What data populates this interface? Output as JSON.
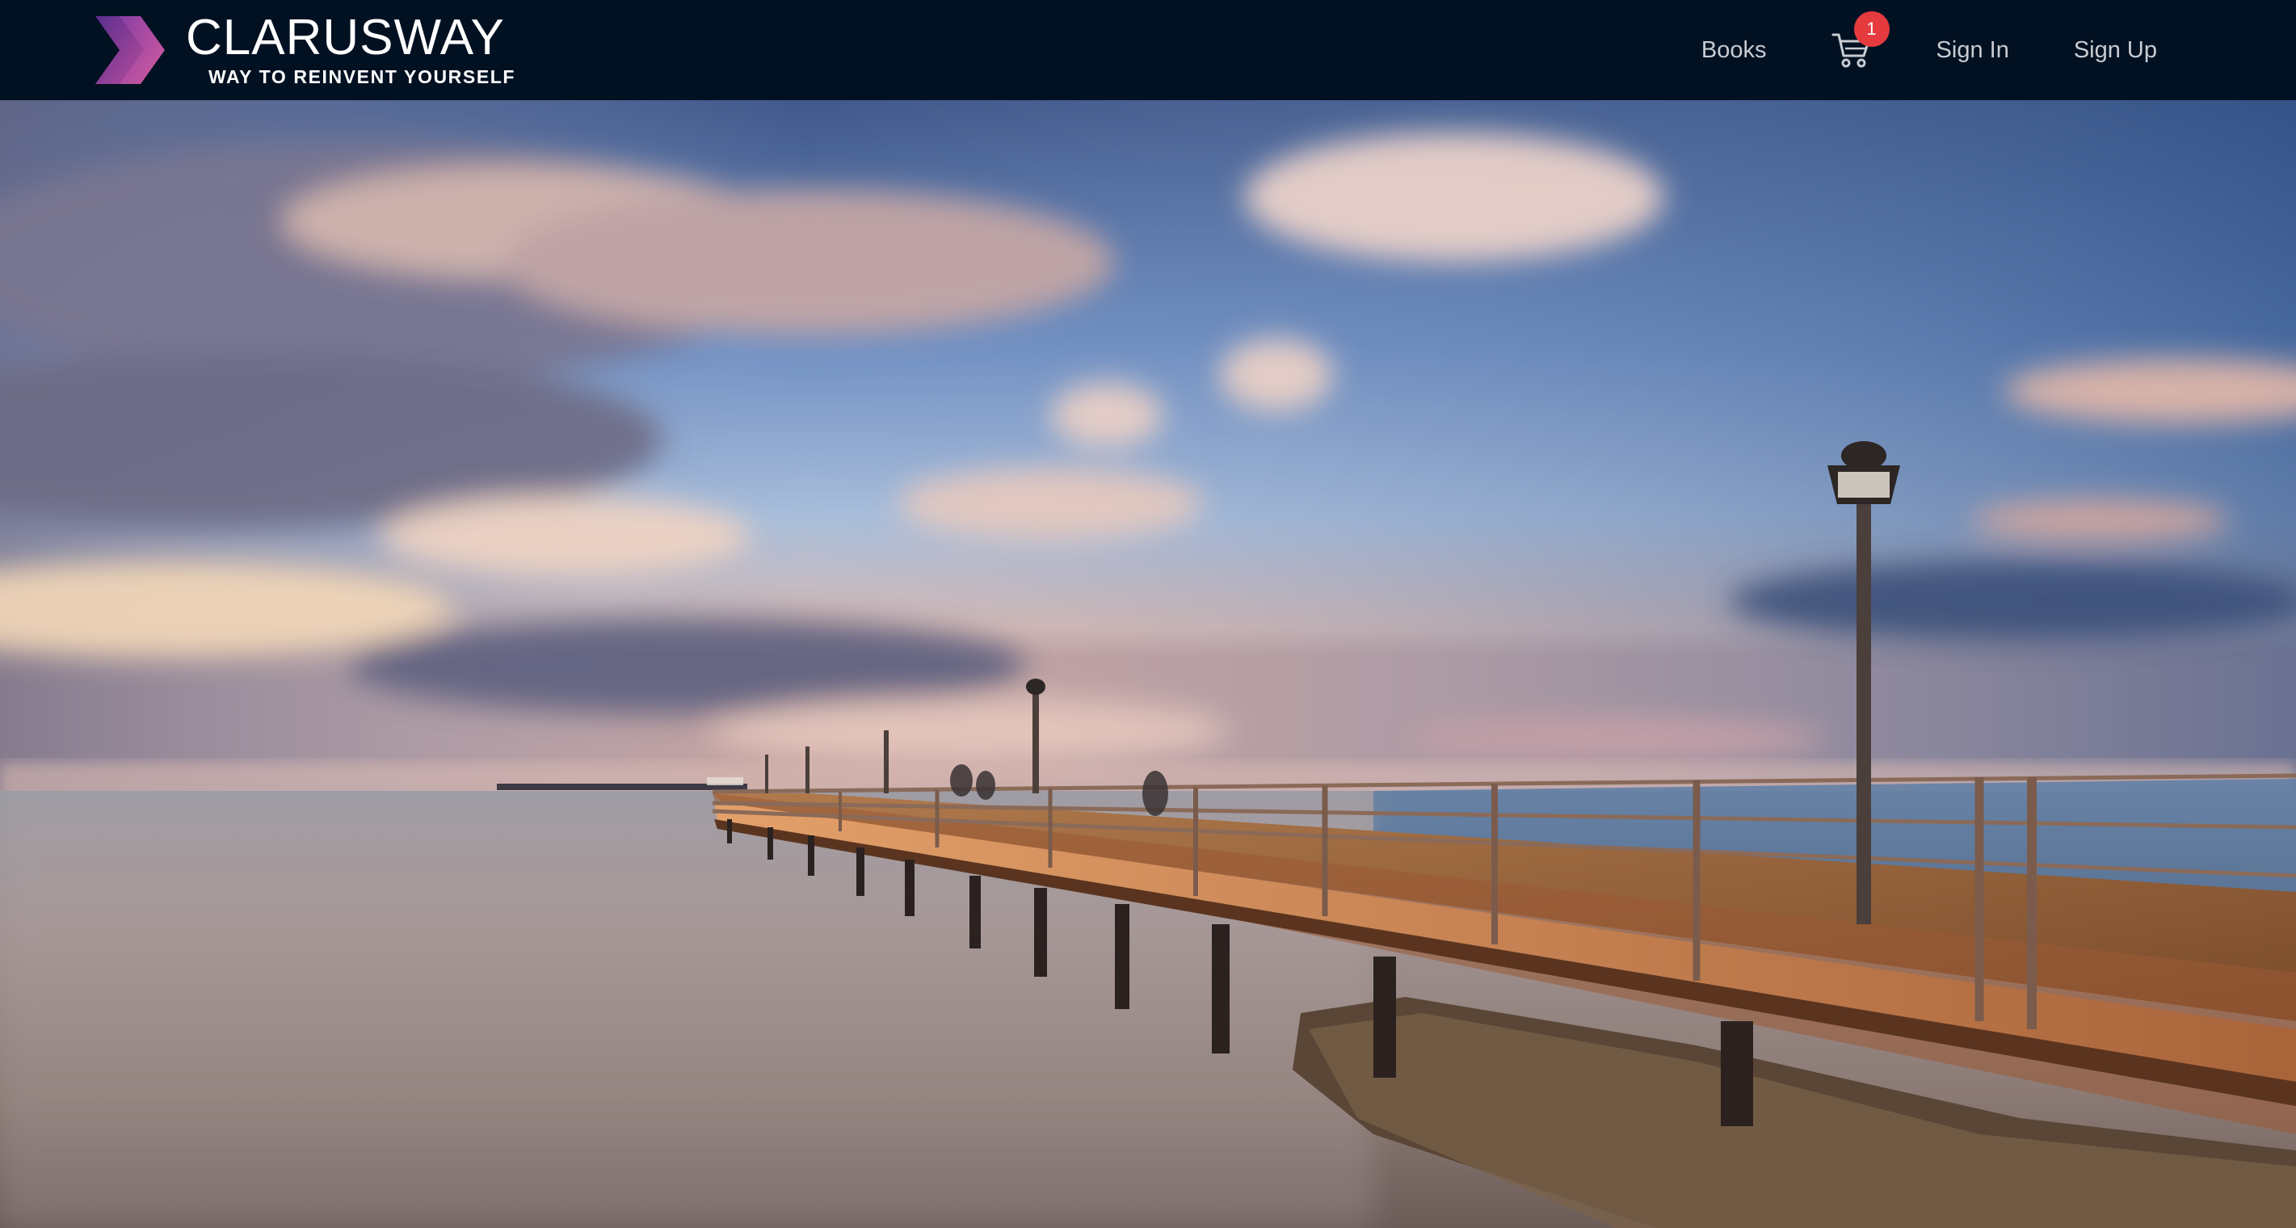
{
  "brand": {
    "name": "CLARUSWAY",
    "tagline": "WAY TO REINVENT YOURSELF",
    "logo_icon": "chevron-double-right-logo",
    "logo_colors": [
      "#7b3fa0",
      "#b14b9e"
    ]
  },
  "nav": {
    "books_label": "Books",
    "cart_icon": "shopping-cart-icon",
    "cart_count": "1",
    "signin_label": "Sign In",
    "signup_label": "Sign Up"
  },
  "hero": {
    "image_icon": "pier-sunset-hero-image"
  },
  "colors": {
    "navbar_bg": "#021122",
    "nav_text": "#c8ccd2",
    "badge": "#e53b3f"
  }
}
